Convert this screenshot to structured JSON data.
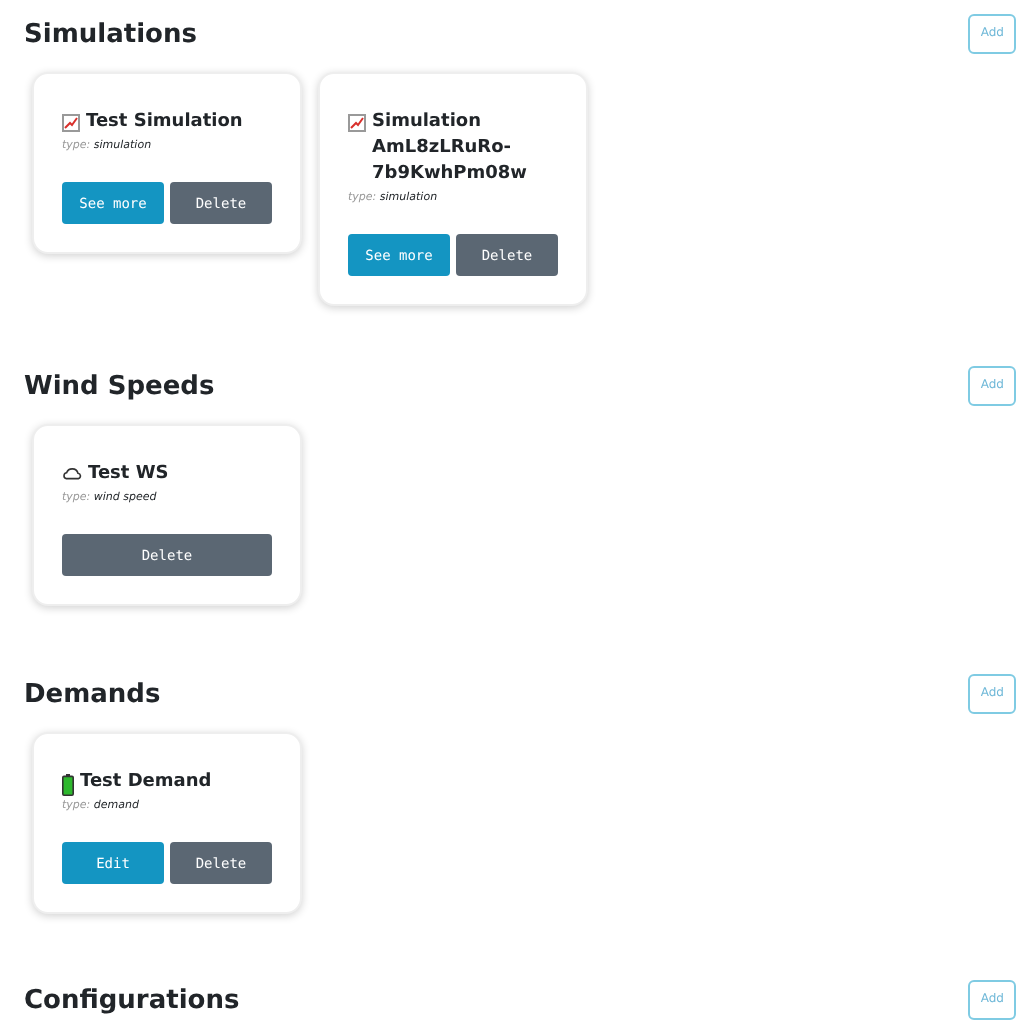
{
  "sections": [
    {
      "title": "Simulations",
      "add_button": "Add",
      "cards": [
        {
          "kind": "chart",
          "name": "Test Simulation",
          "type_label": "type:",
          "type": "simulation",
          "buttons": [
            {
              "label": "See more",
              "kind": "primary"
            },
            {
              "label": "Delete",
              "kind": "secondary"
            }
          ]
        },
        {
          "kind": "chart",
          "name": "Simulation AmL8zLRuRo-7b9KwhPm08w",
          "type_label": "type:",
          "type": "simulation",
          "buttons": [
            {
              "label": "See more",
              "kind": "primary"
            },
            {
              "label": "Delete",
              "kind": "secondary"
            }
          ]
        }
      ]
    },
    {
      "title": "Wind Speeds",
      "add_button": "Add",
      "cards": [
        {
          "kind": "cloud",
          "name": "Test WS",
          "type_label": "type:",
          "type": "wind speed",
          "buttons": [
            {
              "label": "Delete",
              "kind": "secondary"
            }
          ]
        }
      ]
    },
    {
      "title": "Demands",
      "add_button": "Add",
      "cards": [
        {
          "kind": "battery",
          "name": "Test Demand",
          "type_label": "type:",
          "type": "demand",
          "buttons": [
            {
              "label": "Edit",
              "kind": "primary"
            },
            {
              "label": "Delete",
              "kind": "secondary"
            }
          ]
        }
      ]
    },
    {
      "title": "Configurations",
      "add_button": "Add"
    }
  ]
}
